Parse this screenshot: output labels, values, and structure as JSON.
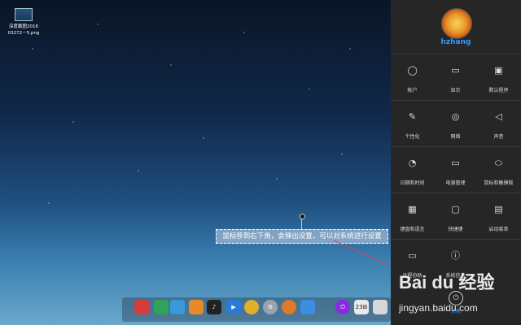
{
  "desktop": {
    "icon_lines": [
      "深度截图2016",
      "03272－5.png"
    ],
    "tooltip": "鼠标移到右下角，会弹出设置，可以对系统进行设置"
  },
  "dock": {
    "items": [
      {
        "icon": "launcher-rocket-icon",
        "color": "#d63b3b",
        "label": ""
      },
      {
        "icon": "photo-manager-icon",
        "color": "#2fa35a",
        "label": ""
      },
      {
        "icon": "file-manager-icon",
        "color": "#3a9ad9",
        "label": ""
      },
      {
        "icon": "app-store-icon",
        "color": "#e8892a",
        "label": ""
      },
      {
        "icon": "music-player-icon",
        "color": "#222222",
        "label": "♪"
      },
      {
        "icon": "video-player-icon",
        "color": "#2b7bd6",
        "label": "▶"
      },
      {
        "icon": "chrome-browser-icon",
        "color": "#e0b02a",
        "label": ""
      },
      {
        "icon": "settings-gear-icon",
        "color": "#9aa3b0",
        "label": "⚙"
      },
      {
        "icon": "browser-icon",
        "color": "#e07a2a",
        "label": ""
      },
      {
        "icon": "app-grid-icon",
        "color": "#3a8fe0",
        "label": ""
      },
      {
        "icon": "power-icon",
        "color": "#8a2be2",
        "label": "⏻"
      },
      {
        "icon": "calendar-icon",
        "color": "#e9e9e9",
        "label": "23⊞"
      },
      {
        "icon": "trash-icon",
        "color": "#d8d8d8",
        "label": ""
      }
    ]
  },
  "panel": {
    "username": "hzhang",
    "tiles": [
      [
        {
          "label": "帐户",
          "icon": "user-icon"
        },
        {
          "label": "显示",
          "icon": "monitor-icon"
        },
        {
          "label": "默认程序",
          "icon": "default-apps-icon"
        }
      ],
      [
        {
          "label": "个性化",
          "icon": "palette-icon"
        },
        {
          "label": "网络",
          "icon": "globe-icon"
        },
        {
          "label": "声音",
          "icon": "speaker-icon"
        }
      ],
      [
        {
          "label": "日期和时间",
          "icon": "clock-icon"
        },
        {
          "label": "电源管理",
          "icon": "battery-icon"
        },
        {
          "label": "鼠标和触摸板",
          "icon": "mouse-icon"
        }
      ],
      [
        {
          "label": "键盘和语言",
          "icon": "keyboard-icon"
        },
        {
          "label": "快捷键",
          "icon": "shortcut-icon"
        },
        {
          "label": "启动菜单",
          "icon": "boot-menu-icon"
        }
      ],
      [
        {
          "label": "远程协助",
          "icon": "remote-icon"
        },
        {
          "label": "系统信息",
          "icon": "info-icon"
        }
      ]
    ],
    "power_label": "关机"
  },
  "watermark": {
    "text": "Bai du 经验",
    "sub": "jingyan.baidu.com"
  }
}
